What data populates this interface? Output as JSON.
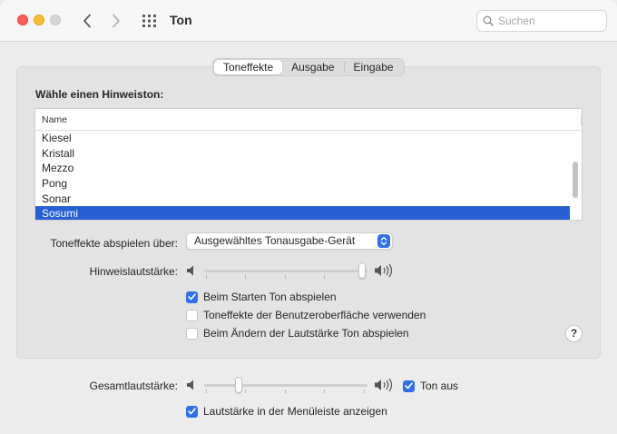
{
  "window": {
    "title": "Ton",
    "search": {
      "placeholder": "Suchen"
    }
  },
  "tabs": [
    {
      "label": "Toneffekte",
      "active": true
    },
    {
      "label": "Ausgabe",
      "active": false
    },
    {
      "label": "Eingabe",
      "active": false
    }
  ],
  "alert": {
    "heading": "Wähle einen Hinweiston:",
    "column_header": "Name",
    "items": [
      "Kiesel",
      "Kristall",
      "Mezzo",
      "Pong",
      "Sonar",
      "Sosumi"
    ],
    "selected": "Sosumi"
  },
  "output": {
    "label": "Toneffekte abspielen über:",
    "value": "Ausgewähltes Tonausgabe-Gerät"
  },
  "alert_volume": {
    "label": "Hinweislautstärke:",
    "level": 1.0
  },
  "options": [
    {
      "label": "Beim Starten Ton abspielen",
      "checked": true
    },
    {
      "label": "Toneffekte der Benutzeroberfläche verwenden",
      "checked": false
    },
    {
      "label": "Beim Ändern der Lautstärke Ton abspielen",
      "checked": false
    }
  ],
  "help_label": "?",
  "master_volume": {
    "label": "Gesamtlautstärke:",
    "level": 0.2,
    "mute_label": "Ton aus",
    "muted": true
  },
  "menubar_option": {
    "label": "Lautstärke in der Menüleiste anzeigen",
    "checked": true
  },
  "colors": {
    "accent": "#2f6fe8",
    "selection": "#2760d2",
    "close": "#fe5f57",
    "minimize": "#febc2e",
    "zoom_disabled": "#d5d5d5"
  },
  "icons": [
    "chevron-left-icon",
    "chevron-right-icon",
    "grid-icon",
    "search-icon",
    "speaker-low-icon",
    "speaker-high-icon",
    "checkmark-icon",
    "popup-arrows-icon"
  ]
}
